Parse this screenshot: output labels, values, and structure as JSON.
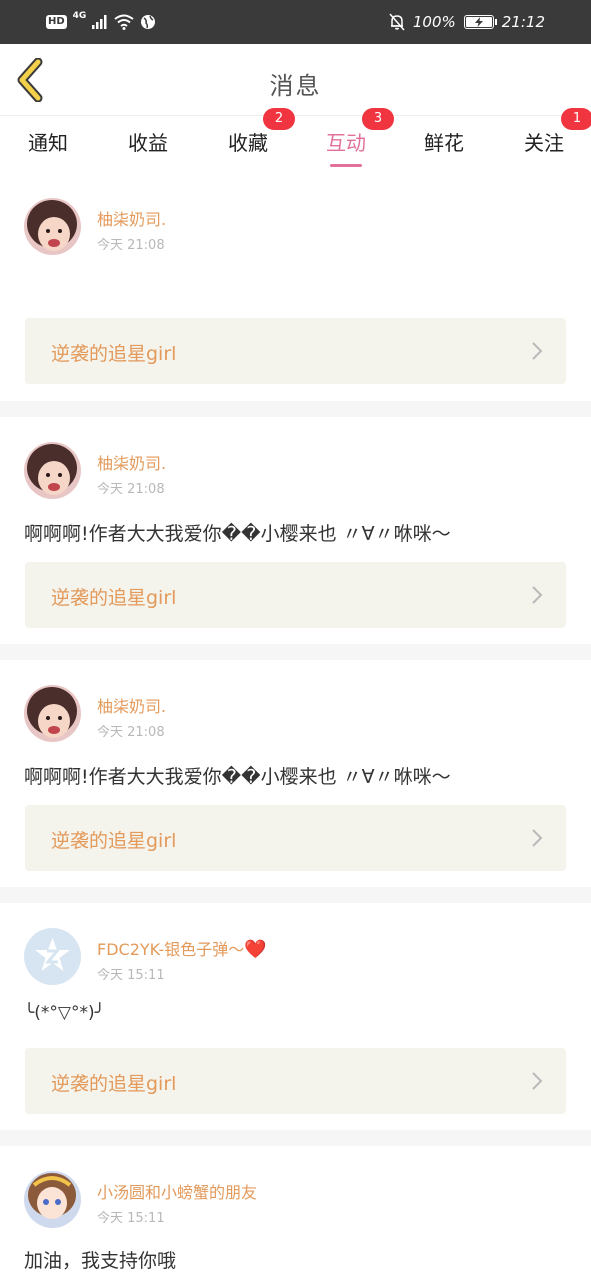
{
  "status_bar": {
    "hd": "HD",
    "network": "4G",
    "battery_text": "100%",
    "battery_level": 1.0,
    "time": "21:12"
  },
  "header": {
    "title": "消息"
  },
  "tabs": [
    {
      "label": "通知",
      "badge": ""
    },
    {
      "label": "收益",
      "badge": ""
    },
    {
      "label": "收藏",
      "badge": "2"
    },
    {
      "label": "互动",
      "badge": "3",
      "active": true
    },
    {
      "label": "鲜花",
      "badge": ""
    },
    {
      "label": "关注",
      "badge": "1"
    }
  ],
  "feed": [
    {
      "user": "柚柒奶司.",
      "time": "今天 21:08",
      "content": "",
      "book": "逆袭的追星girl"
    },
    {
      "user": "柚柒奶司.",
      "time": "今天 21:08",
      "content": "啊啊啊!作者大大我爱你��小樱来也 〃∀〃咻咪～",
      "book": "逆袭的追星girl"
    },
    {
      "user": "柚柒奶司.",
      "time": "今天 21:08",
      "content": "啊啊啊!作者大大我爱你��小樱来也 〃∀〃咻咪～",
      "book": "逆袭的追星girl"
    },
    {
      "user": "FDC2YK-银色子弹～",
      "user_emoji": "❤️",
      "time": "今天 15:11",
      "content": "╰(*°▽°*)╯",
      "book": "逆袭的追星girl"
    },
    {
      "user": "小汤圆和小螃蟹的朋友",
      "time": "今天 15:11",
      "content": "加油，我支持你哦",
      "book": ""
    }
  ],
  "colors": {
    "accent": "#e2709b",
    "name": "#e39a5b",
    "badge": "#f03540",
    "book_bg": "#f4f3ec"
  }
}
